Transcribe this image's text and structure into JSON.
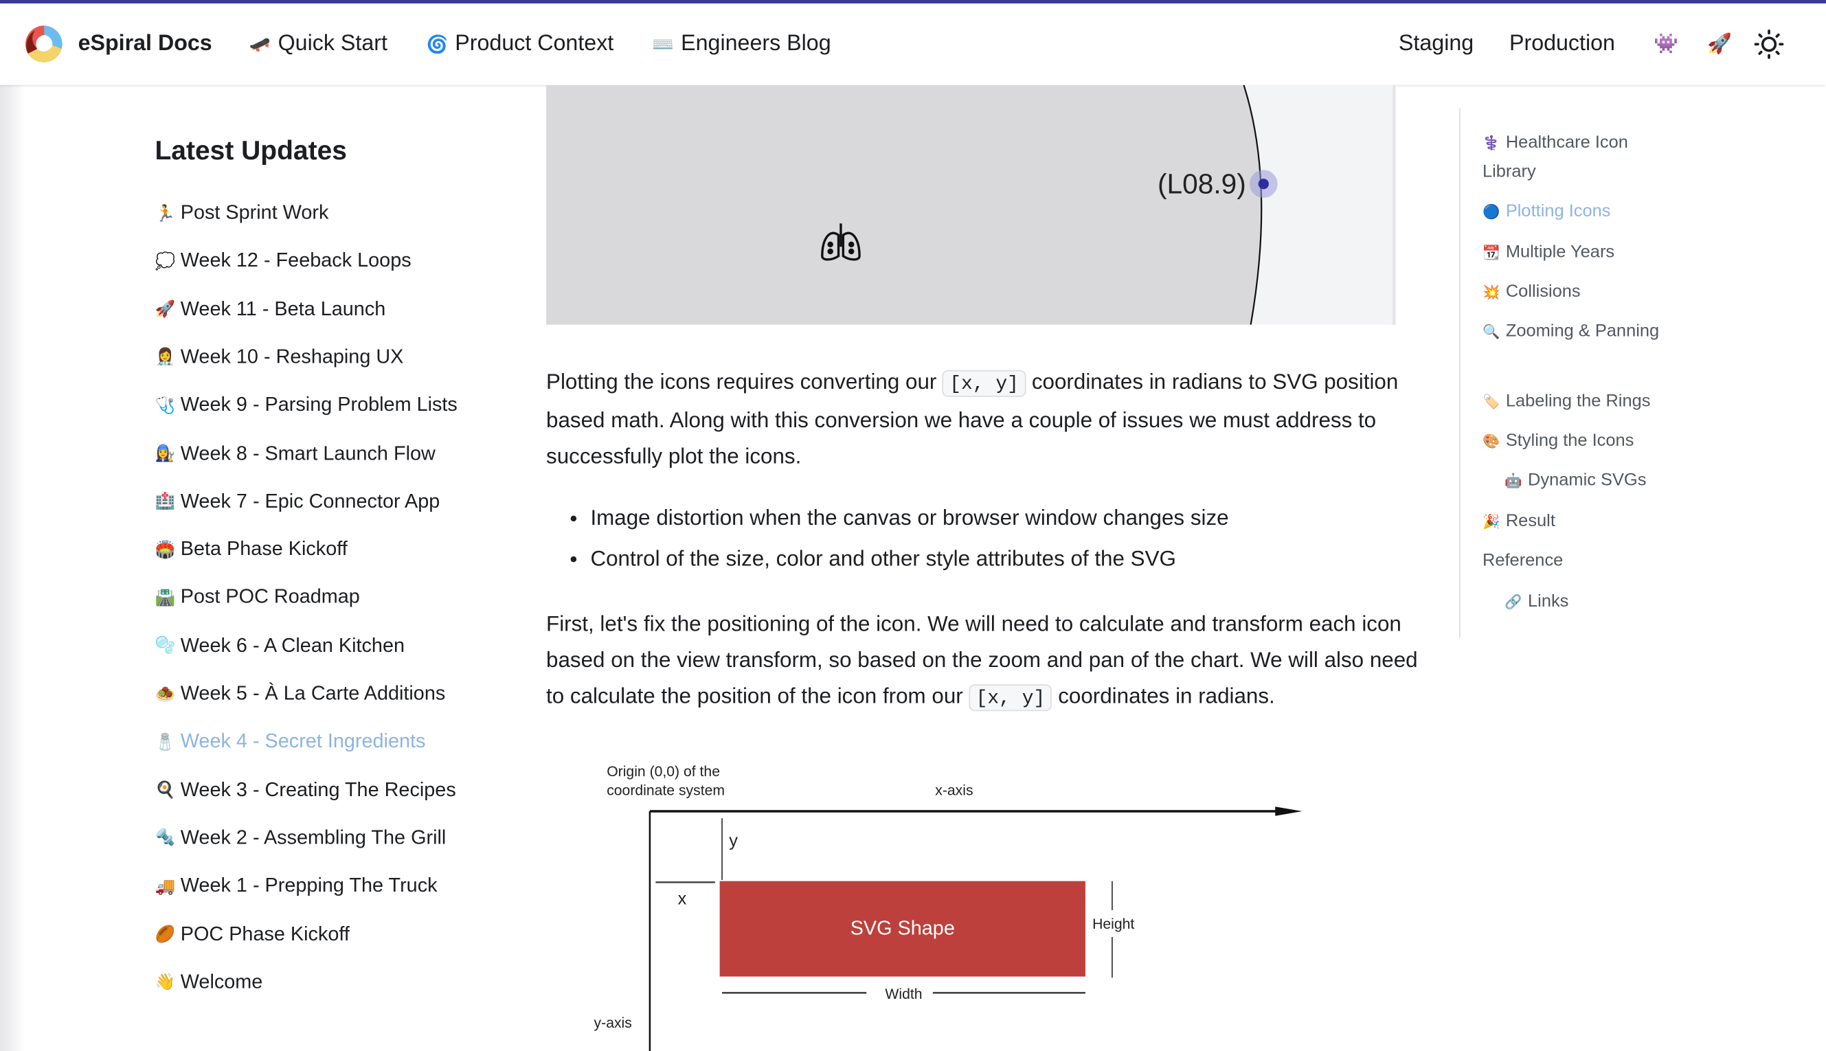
{
  "colors": {
    "accent": "#8db4e2",
    "topbar": "#3b3c94",
    "svg_shape": "#bd403c",
    "point": "#2e2e9e"
  },
  "nav": {
    "brand": "eSpiral Docs",
    "links": [
      {
        "label": "Quick Start",
        "icon": "🛹"
      },
      {
        "label": "Product Context",
        "icon": "🌀"
      },
      {
        "label": "Engineers Blog",
        "icon": "⌨️"
      }
    ],
    "right": [
      {
        "label": "Staging"
      },
      {
        "label": "Production"
      }
    ],
    "icons": {
      "alien": "👾",
      "rocket": "🚀",
      "theme": "sun-icon"
    }
  },
  "sidebar": {
    "title": "Latest Updates",
    "items": [
      {
        "icon": "🏃",
        "label": "Post Sprint Work"
      },
      {
        "icon": "💭",
        "label": "Week 12 - Feeback Loops"
      },
      {
        "icon": "🚀",
        "label": "Week 11 - Beta Launch"
      },
      {
        "icon": "👩‍⚕️",
        "label": "Week 10 - Reshaping UX"
      },
      {
        "icon": "🩺",
        "label": "Week 9 - Parsing Problem Lists"
      },
      {
        "icon": "👩‍🔧",
        "label": "Week 8 - Smart Launch Flow"
      },
      {
        "icon": "🏥",
        "label": "Week 7 - Epic Connector App"
      },
      {
        "icon": "🏟️",
        "label": "Beta Phase Kickoff"
      },
      {
        "icon": "🛣️",
        "label": "Post POC Roadmap"
      },
      {
        "icon": "🫧",
        "label": "Week 6 - A Clean Kitchen"
      },
      {
        "icon": "🧆",
        "label": "Week 5 - À La Carte Additions"
      },
      {
        "icon": "🧂",
        "label": "Week 4 - Secret Ingredients",
        "active": true
      },
      {
        "icon": "🍳",
        "label": "Week 3 - Creating The Recipes"
      },
      {
        "icon": "🔩",
        "label": "Week 2 - Assembling The Grill"
      },
      {
        "icon": "🚚",
        "label": "Week 1 - Prepping The Truck"
      },
      {
        "icon": "🏉",
        "label": "POC Phase Kickoff"
      },
      {
        "icon": "👋",
        "label": "Welcome"
      }
    ]
  },
  "hero": {
    "label": "(L08.9)",
    "icon": "lungs-icon"
  },
  "content": {
    "p1_a": "Plotting the icons requires converting our ",
    "p1_code": "[x, y]",
    "p1_b": " coordinates in radians to SVG position based math. Along with this conversion we have a couple of issues we must address to successfully plot the icons.",
    "bullets": [
      "Image distortion when the canvas or browser window changes size",
      "Control of the size, color and other style attributes of the SVG"
    ],
    "p2_a": "First, let's fix the positioning of the icon. We will need to calculate and transform each icon based on the view transform, so based on the zoom and pan of the chart. We will also need to calculate the position of the icon from our ",
    "p2_code": "[x, y]",
    "p2_b": " coordinates in radians."
  },
  "diagram": {
    "origin_1": "Origin (0,0) of the",
    "origin_2": "coordinate system",
    "x_axis": "x-axis",
    "y_axis": "y-axis",
    "x": "x",
    "y": "y",
    "shape": "SVG Shape",
    "height": "Height",
    "width": "Width"
  },
  "toc": [
    {
      "icon": "⚕️",
      "label": "Healthcare Icon Library"
    },
    {
      "icon": "🔵",
      "label": "Plotting Icons",
      "active": true
    },
    {
      "icon": "📆",
      "label": "Multiple Years"
    },
    {
      "icon": "💥",
      "label": "Collisions"
    },
    {
      "icon": "🔍",
      "label": "Zooming & Panning"
    },
    {
      "icon": "🏷️",
      "label": "Labeling the Rings"
    },
    {
      "icon": "🎨",
      "label": "Styling the Icons"
    },
    {
      "icon": "🤖",
      "label": "Dynamic SVGs"
    },
    {
      "icon": "🎉",
      "label": "Result"
    },
    {
      "icon": "",
      "label": "Reference"
    },
    {
      "icon": "🔗",
      "label": "Links"
    }
  ]
}
